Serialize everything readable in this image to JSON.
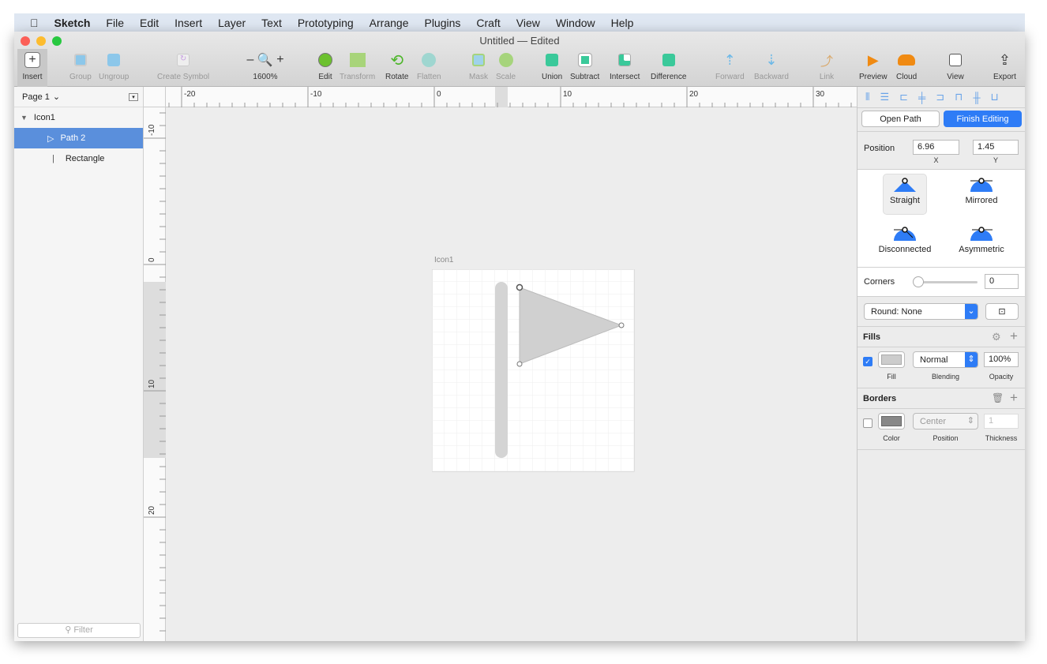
{
  "menubar": {
    "apple": "",
    "items": [
      "Sketch",
      "File",
      "Edit",
      "Insert",
      "Layer",
      "Text",
      "Prototyping",
      "Arrange",
      "Plugins",
      "Craft",
      "View",
      "Window",
      "Help"
    ]
  },
  "window": {
    "title": "Untitled — Edited"
  },
  "toolbar": {
    "insert": "Insert",
    "group": "Group",
    "ungroup": "Ungroup",
    "create_symbol": "Create Symbol",
    "zoom": "1600%",
    "zoom_minus": "–",
    "zoom_plus": "+",
    "edit": "Edit",
    "transform": "Transform",
    "rotate": "Rotate",
    "flatten": "Flatten",
    "mask": "Mask",
    "scale": "Scale",
    "union": "Union",
    "subtract": "Subtract",
    "intersect": "Intersect",
    "difference": "Difference",
    "forward": "Forward",
    "backward": "Backward",
    "link": "Link",
    "preview": "Preview",
    "cloud": "Cloud",
    "view": "View",
    "export": "Export"
  },
  "layers": {
    "page": "Page 1",
    "items": [
      {
        "name": "Icon1",
        "type": "artboard"
      },
      {
        "name": "Path 2",
        "type": "path",
        "selected": true
      },
      {
        "name": "Rectangle",
        "type": "rect"
      }
    ],
    "filter_placeholder": "Filter"
  },
  "rulers": {
    "h_labels": [
      "-20",
      "-10",
      "0",
      "10",
      "20",
      "30"
    ],
    "v_labels": [
      "-10",
      "0",
      "10",
      "20"
    ]
  },
  "canvas": {
    "artboard_name": "Icon1"
  },
  "inspector": {
    "open_path": "Open Path",
    "finish_editing": "Finish Editing",
    "position_label": "Position",
    "x": "6.96",
    "y": "1.45",
    "x_label": "X",
    "y_label": "Y",
    "point_types": [
      "Straight",
      "Mirrored",
      "Disconnected",
      "Asymmetric"
    ],
    "selected_point_type": "Straight",
    "corners_label": "Corners",
    "corners_value": "0",
    "round": "Round: None",
    "fills_label": "Fills",
    "fill_enabled": true,
    "fill_color": "#cccccc",
    "fill_label": "Fill",
    "blending": "Normal",
    "blending_label": "Blending",
    "opacity": "100%",
    "opacity_label": "Opacity",
    "borders_label": "Borders",
    "border_enabled": false,
    "border_color": "#888888",
    "color_label": "Color",
    "border_position": "Center",
    "position_label2": "Position",
    "thickness": "1",
    "thickness_label": "Thickness"
  },
  "colors": {
    "accent": "#2e7cf6",
    "selection": "#5a8fdc"
  }
}
